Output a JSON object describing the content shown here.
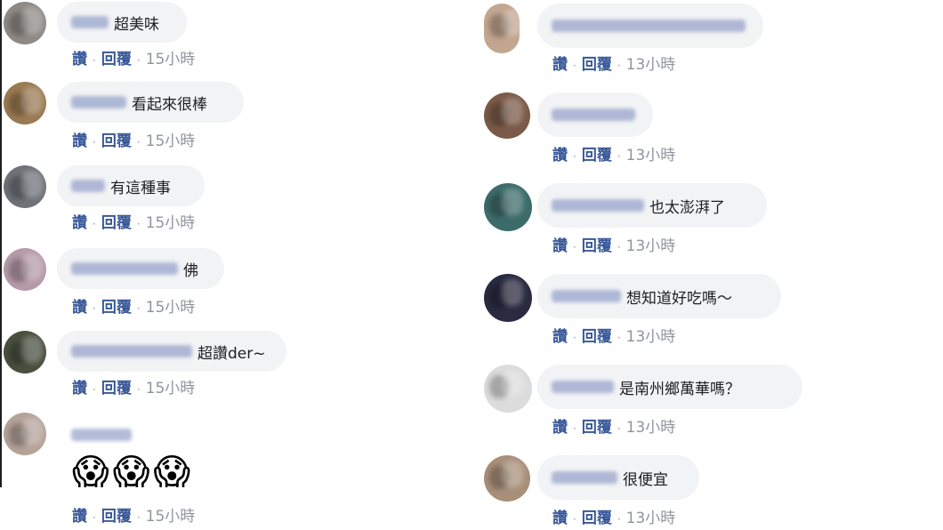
{
  "ui": {
    "like": "讚",
    "reply": "回覆"
  },
  "left_comments": [
    {
      "text": "超美味",
      "time": "15小時",
      "avatar": "#8f8a86"
    },
    {
      "text": "看起來很棒",
      "time": "15小時",
      "avatar": "#9a7a52"
    },
    {
      "text": "有這種事",
      "time": "15小時",
      "avatar": "#6f7278"
    },
    {
      "text": "佛",
      "time": "15小時",
      "avatar": "#b59aa8"
    },
    {
      "text": "超讚der~",
      "time": "15小時",
      "avatar": "#4a5040"
    },
    {
      "text": "",
      "emojis": [
        "😱",
        "😱",
        "😱"
      ],
      "time": "15小時",
      "avatar": "#b5a39a"
    }
  ],
  "right_comments": [
    {
      "text": "",
      "time": "13小時",
      "avatar": "#c2a690"
    },
    {
      "text": "",
      "time": "13小時",
      "avatar": "#7b5a48"
    },
    {
      "text": "也太澎湃了",
      "time": "13小時",
      "avatar": "#3c6c6a"
    },
    {
      "text": "想知道好吃嗎～",
      "time": "13小時",
      "avatar": "#2a2a40"
    },
    {
      "text": "是南州鄉萬華嗎？",
      "time": "13小時",
      "avatar": "#dcdcdc"
    },
    {
      "text": "很便宜",
      "time": "13小時",
      "avatar": "#a88f7a"
    }
  ]
}
